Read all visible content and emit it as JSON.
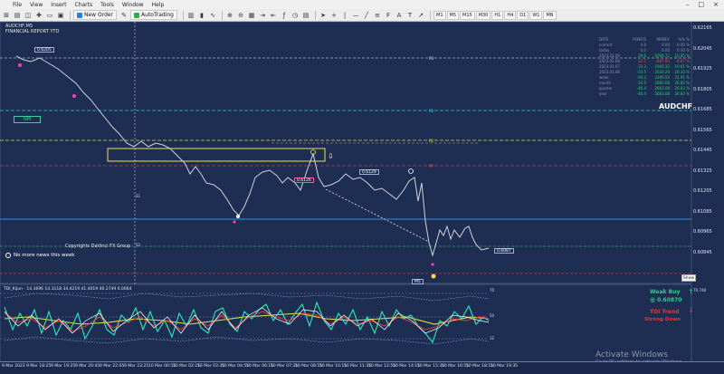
{
  "menu": [
    "File",
    "View",
    "Insert",
    "Charts",
    "Tools",
    "Window",
    "Help"
  ],
  "toolbar": {
    "new_order": "New Order",
    "autotrading": "AutoTrading",
    "timeframes": [
      "M1",
      "M5",
      "M15",
      "M30",
      "H1",
      "H4",
      "D1",
      "W1",
      "MN"
    ]
  },
  "chart": {
    "header_line1": "AUDCHF,M5",
    "header_line2": "FINANCIAL REPORT YTD",
    "symbol": "AUDCHF",
    "nm_label": "NM",
    "copyright": "Copyrights DaVinci FX Group",
    "no_news": "No more news this week",
    "show_button": "Show",
    "price_ticks": [
      "0.62165",
      "0.62045",
      "0.61925",
      "0.61805",
      "0.61685",
      "0.61565",
      "0.61445",
      "0.61325",
      "0.61205",
      "0.61085",
      "0.60965",
      "0.60845"
    ],
    "price_tags": {
      "top_left": "0.6205",
      "mid_right": "0.6129",
      "left_mid": "0.6126",
      "current": "0.6087"
    },
    "level_labels": [
      "R3",
      "R2",
      "R1",
      "PP",
      "S1",
      "S2"
    ],
    "bottom_tag": "M5"
  },
  "report": {
    "headers": [
      "DATE",
      "POINTS",
      "MONEY",
      "%% %"
    ],
    "rows": [
      [
        "current",
        "0.0",
        "0.00",
        "0.00 %"
      ],
      [
        "today",
        "0.0",
        "0.00",
        "0.00 %"
      ],
      [
        "2023.03.09",
        "29.6",
        "1094.72",
        "10.95 %"
      ],
      [
        "2023.03.08",
        "-32.5",
        "-887.95",
        "-8.87 %"
      ],
      [
        "2023.03.07",
        "-33.3",
        "1060.32",
        "10.61 %"
      ],
      [
        "2023.03.06",
        "-53.5",
        "2030.20",
        "20.30 %"
      ],
      [
        "week",
        "-94.2",
        "3190.55",
        "31.91 %"
      ],
      [
        "month",
        "-34.0",
        "2683.08",
        "26.83 %"
      ],
      [
        "quarter",
        "-46.4",
        "2683.08",
        "26.83 %"
      ],
      [
        "year",
        "-46.4",
        "2683.08",
        "26.83 %"
      ]
    ]
  },
  "indicator": {
    "label": "TDI_Kijun - 14.3696 14.3118 34.4219 41.4019 46.2749 0.0064",
    "levels": [
      "70",
      "50",
      "32"
    ],
    "weak": "Weak Buy",
    "weak_value": "@ 0.60870",
    "tdi_trend": "TDI Trend",
    "strong": "Strong Down",
    "ind_scale": "76.748"
  },
  "timescale": [
    "9 Mar 2023",
    "9 Mar 18:25",
    "9 Mar 19:25",
    "9 Mar 20:45",
    "9 Mar 22:05",
    "9 Mar 23:25",
    "10 Mar 00:55",
    "10 Mar 02:15",
    "10 Mar 03:35",
    "10 Mar 04:55",
    "10 Mar 06:15",
    "10 Mar 07:35",
    "10 Mar 08:55",
    "10 Mar 10:15",
    "10 Mar 11:35",
    "10 Mar 12:55",
    "10 Mar 14:15",
    "10 Mar 15:35",
    "10 Mar 16:55",
    "10 Mar 18:15",
    "10 Mar 19:35"
  ],
  "watermark": {
    "title": "Activate Windows",
    "sub": "Go to PC settings to activate Windows."
  },
  "colors": {
    "bg": "#1e2e52",
    "accent_green": "#22d18a",
    "accent_red": "#ff2a2a",
    "level_yellow": "#d9d24a",
    "level_blue": "#2f8cff"
  }
}
